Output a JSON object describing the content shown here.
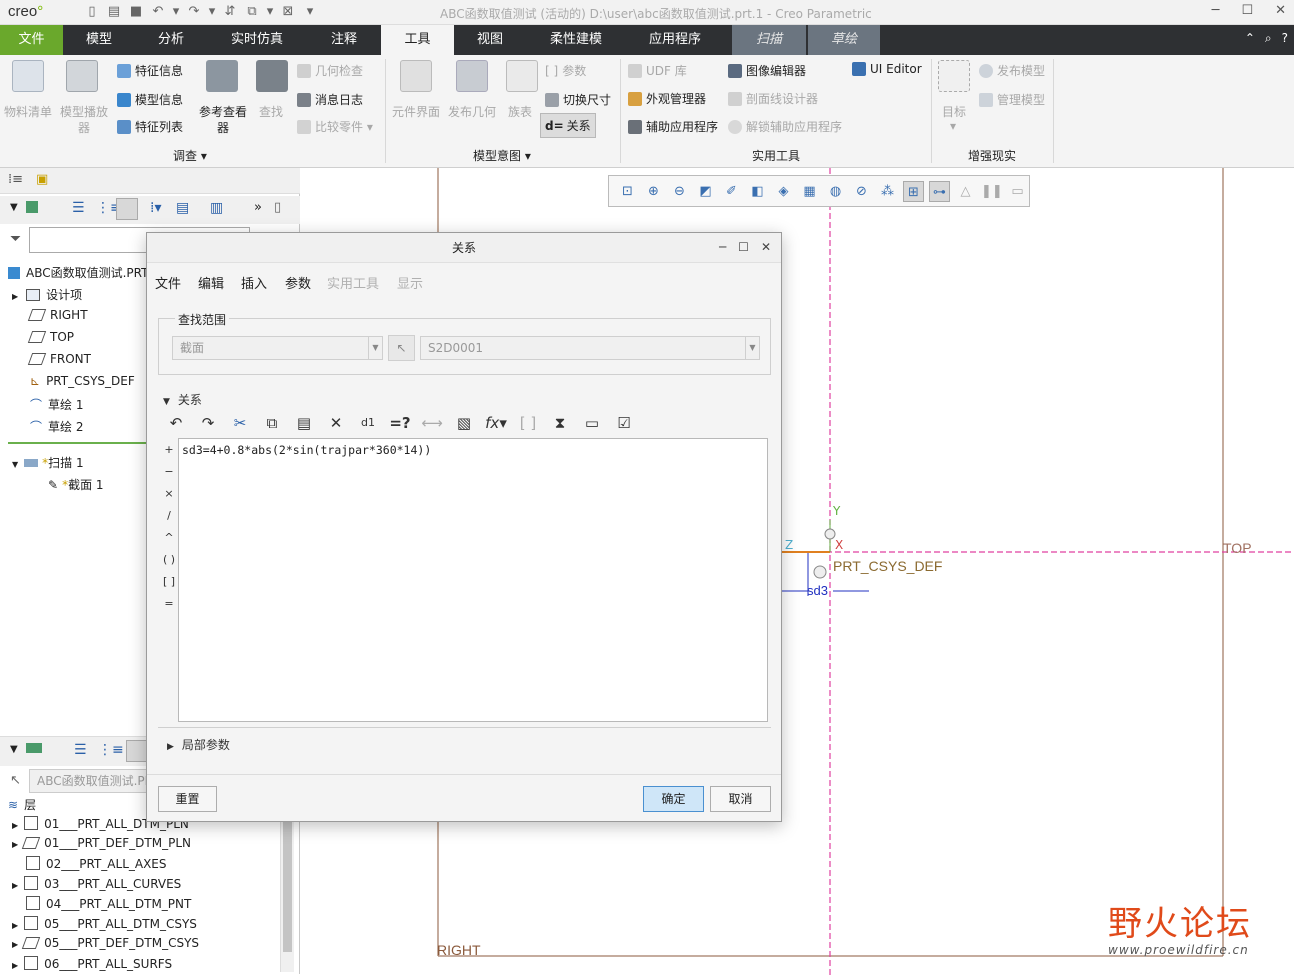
{
  "app": {
    "logo": "creo",
    "window_title": "ABC函数取值测试 (活动的) D:\\user\\abc函数取值测试.prt.1 - Creo Parametric"
  },
  "tabs": [
    {
      "label": "文件"
    },
    {
      "label": "模型"
    },
    {
      "label": "分析"
    },
    {
      "label": "实时仿真"
    },
    {
      "label": "注释"
    },
    {
      "label": "工具"
    },
    {
      "label": "视图"
    },
    {
      "label": "柔性建模"
    },
    {
      "label": "应用程序"
    },
    {
      "label": "扫描"
    },
    {
      "label": "草绘"
    }
  ],
  "ribbon": {
    "bom": "物料清单",
    "model_player_1": "模型播放",
    "model_player_2": "器",
    "feature_info": "特征信息",
    "model_info": "模型信息",
    "feature_list": "特征列表",
    "ref_viewer_1": "参考查看",
    "ref_viewer_2": "器",
    "find": "查找",
    "geom_check": "几何检查",
    "message_log": "消息日志",
    "compare_part": "比较零件",
    "group_investigate": "调查",
    "component_interface": "元件界面",
    "publish_geom": "发布几何",
    "family_table": "族表",
    "params": "参数",
    "switch_dims": "切换尺寸",
    "relations": "关系",
    "group_model_intent": "模型意图",
    "udf_lib": "UDF 库",
    "image_editor": "图像编辑器",
    "ui_editor": "UI Editor",
    "appearance_mgr": "外观管理器",
    "section_designer": "剖面线设计器",
    "aux_apps": "辅助应用程序",
    "release_aux": "解锁辅助应用程序",
    "group_utilities": "实用工具",
    "target": "目标",
    "publish_model": "发布模型",
    "manage_model": "管理模型",
    "group_ar": "增强现实"
  },
  "model_tree": {
    "root": "ABC函数取值测试.PRT",
    "items": [
      {
        "label": "设计项"
      },
      {
        "label": "RIGHT"
      },
      {
        "label": "TOP"
      },
      {
        "label": "FRONT"
      },
      {
        "label": "PRT_CSYS_DEF"
      },
      {
        "label": "草绘 1"
      },
      {
        "label": "草绘 2"
      }
    ],
    "sweep": "扫描 1",
    "section": "截面 1"
  },
  "layer_tree": {
    "header": "ABC函数取值测试.PRT",
    "title": "层",
    "items": [
      {
        "label": "01___PRT_ALL_DTM_PLN"
      },
      {
        "label": "01___PRT_DEF_DTM_PLN"
      },
      {
        "label": "02___PRT_ALL_AXES"
      },
      {
        "label": "03___PRT_ALL_CURVES"
      },
      {
        "label": "04___PRT_ALL_DTM_PNT"
      },
      {
        "label": "05___PRT_ALL_DTM_CSYS"
      },
      {
        "label": "05___PRT_DEF_DTM_CSYS"
      },
      {
        "label": "06___PRT_ALL_SURFS"
      }
    ]
  },
  "canvas": {
    "csys_label": "PRT_CSYS_DEF",
    "top_label": "TOP",
    "right_label": "RIGHT",
    "dim_label": "sd3",
    "axis_y": "Y",
    "axis_z": "Z",
    "axis_x": "X"
  },
  "dialog": {
    "title": "关系",
    "menu": [
      "文件",
      "编辑",
      "插入",
      "参数",
      "实用工具",
      "显示"
    ],
    "lookup_label": "查找范围",
    "lookup_type": "截面",
    "lookup_item": "S2D0001",
    "relations_label": "关系",
    "relation_text": "sd3=4+0.8*abs(2*sin(trajpar*360*14))",
    "operators": [
      "+",
      "−",
      "×",
      "/",
      "^",
      "( )",
      "[ ]",
      "="
    ],
    "local_params": "局部参数",
    "reset": "重置",
    "ok": "确定",
    "cancel": "取消"
  },
  "watermark": {
    "title": "野火论坛",
    "url": "www.proewildfire.cn"
  }
}
